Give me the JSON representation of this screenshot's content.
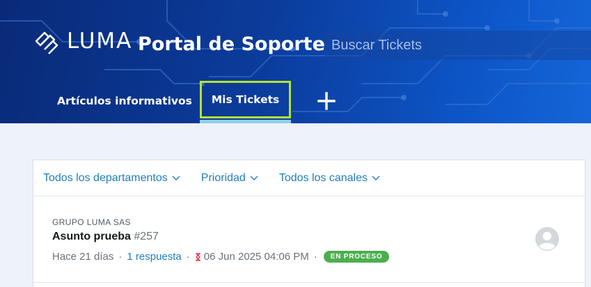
{
  "header": {
    "logo_text": "LUMA",
    "portal_title": "Portal de Soporte",
    "search_placeholder": "Buscar Tickets"
  },
  "nav": {
    "tabs": [
      {
        "label": "Artículos informativos"
      },
      {
        "label": "Mis Tickets",
        "active": true
      }
    ],
    "add_icon": "plus-icon"
  },
  "filters": [
    {
      "label": "Todos los departamentos",
      "icon": "chevron-down-icon"
    },
    {
      "label": "Prioridad",
      "icon": "chevron-down-icon"
    },
    {
      "label": "Todos los canales",
      "icon": "chevron-down-icon"
    }
  ],
  "tickets": [
    {
      "company": "GRUPO LUMA SAS",
      "subject": "Asunto prueba",
      "number": "#257",
      "age": "Hace 21 días",
      "replies": "1 respuesta",
      "due": "06 Jun 2025 04:06 PM",
      "status": "EN PROCESO",
      "separator": "·"
    }
  ],
  "colors": {
    "accent": "#1f7ec0",
    "active_tab_outline": "#b4e32f",
    "status_badge": "#4cae4f"
  }
}
